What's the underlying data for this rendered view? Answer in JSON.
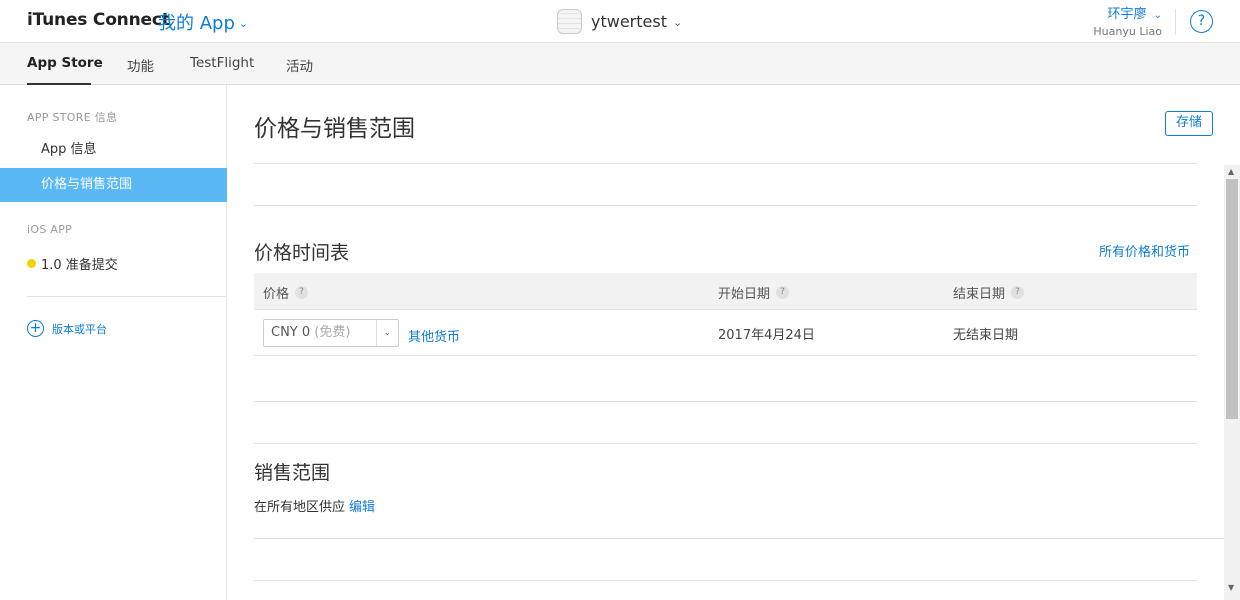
{
  "header": {
    "brand": "iTunes Connect",
    "my_app": "我的 App",
    "app_name": "ytwertest",
    "user_cn": "环宇廖",
    "user_en": "Huanyu Liao",
    "help_glyph": "?",
    "chevron": "⌄"
  },
  "nav": {
    "tabs": [
      {
        "label": "App Store",
        "active": true
      },
      {
        "label": "功能"
      },
      {
        "label": "TestFlight"
      },
      {
        "label": "活动"
      }
    ]
  },
  "sidebar": {
    "section1": "APP STORE 信息",
    "items": [
      "App 信息",
      "价格与销售范围"
    ],
    "section2": "iOS APP",
    "status_item": "1.0 准备提交",
    "status_color": "#f0d400",
    "add_label": "版本或平台",
    "add_glyph": "+"
  },
  "main": {
    "title": "价格与销售范围",
    "save_label": "存储",
    "schedule_title": "价格时间表",
    "all_prices_link": "所有价格和货币",
    "table": {
      "headers": [
        "价格",
        "开始日期",
        "结束日期"
      ],
      "help_glyph": "?",
      "row": {
        "price_value": "CNY 0",
        "price_note": "(免费)",
        "other_currency": "其他货币",
        "start_date": "2017年4月24日",
        "end_date": "无结束日期"
      }
    },
    "sales_title": "销售范围",
    "sales_text": "在所有地区供应",
    "sales_edit": "编辑"
  },
  "colors": {
    "accent": "#0f7dd8",
    "active_sidebar": "#5ab8f5"
  }
}
